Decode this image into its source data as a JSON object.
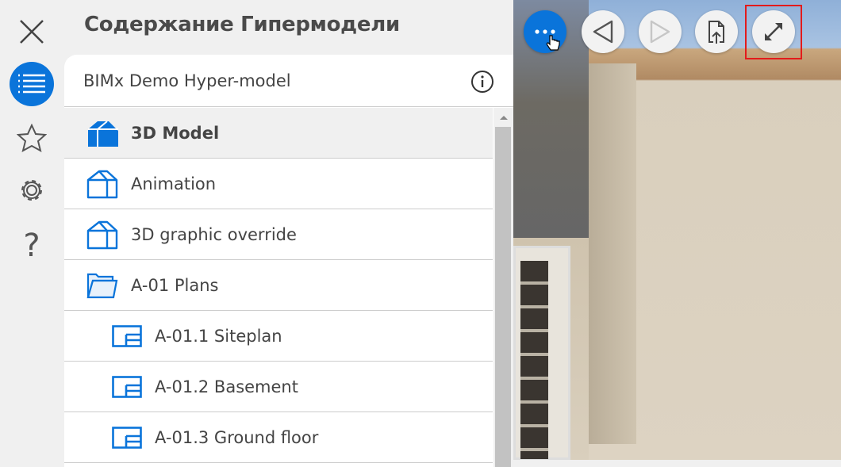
{
  "panel": {
    "title": "Содержание Гипермодели",
    "model_name": "BIMx Demo Hyper-model"
  },
  "items": [
    {
      "label": "3D Model",
      "icon": "3d-model-filled-icon",
      "selected": true
    },
    {
      "label": "Animation",
      "icon": "3d-model-icon"
    },
    {
      "label": "3D graphic override",
      "icon": "3d-model-icon"
    },
    {
      "label": "A-01 Plans",
      "icon": "folder-open-icon"
    },
    {
      "label": "A-01.1 Siteplan",
      "icon": "layout-icon"
    },
    {
      "label": "A-01.2 Basement",
      "icon": "layout-icon"
    },
    {
      "label": "A-01.3 Ground floor",
      "icon": "layout-icon"
    }
  ],
  "colors": {
    "accent": "#0a74da",
    "highlight": "#e31b1b"
  }
}
